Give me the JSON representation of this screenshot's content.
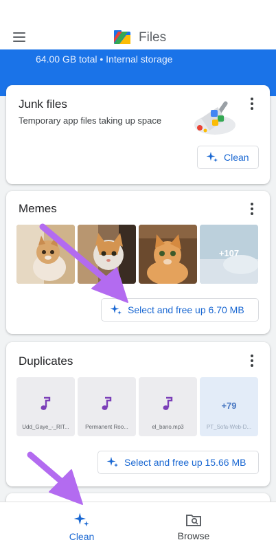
{
  "app": {
    "title": "Files",
    "storage_summary": "64.00 GB total • Internal storage",
    "accent_color": "#1a73e8"
  },
  "cards": {
    "junk": {
      "title": "Junk files",
      "subtitle": "Temporary app files taking up space",
      "button_label": "Clean"
    },
    "memes": {
      "title": "Memes",
      "more_count": "+107",
      "button_label": "Select and free up 6.70 MB"
    },
    "duplicates": {
      "title": "Duplicates",
      "files": [
        {
          "name": "Udd_Gaye_-_RIT..."
        },
        {
          "name": "Permanent Roo..."
        },
        {
          "name": "el_bano.mp3"
        },
        {
          "name": "PT_Sofa-Web-D..."
        }
      ],
      "more_count": "+79",
      "button_label": "Select and free up 15.66 MB"
    }
  },
  "bottom_nav": {
    "items": [
      {
        "label": "Clean",
        "icon": "sparkle-icon",
        "active": true
      },
      {
        "label": "Browse",
        "icon": "folder-search-icon",
        "active": false
      }
    ]
  },
  "annotations": {
    "arrow_color": "#b36bf0"
  }
}
